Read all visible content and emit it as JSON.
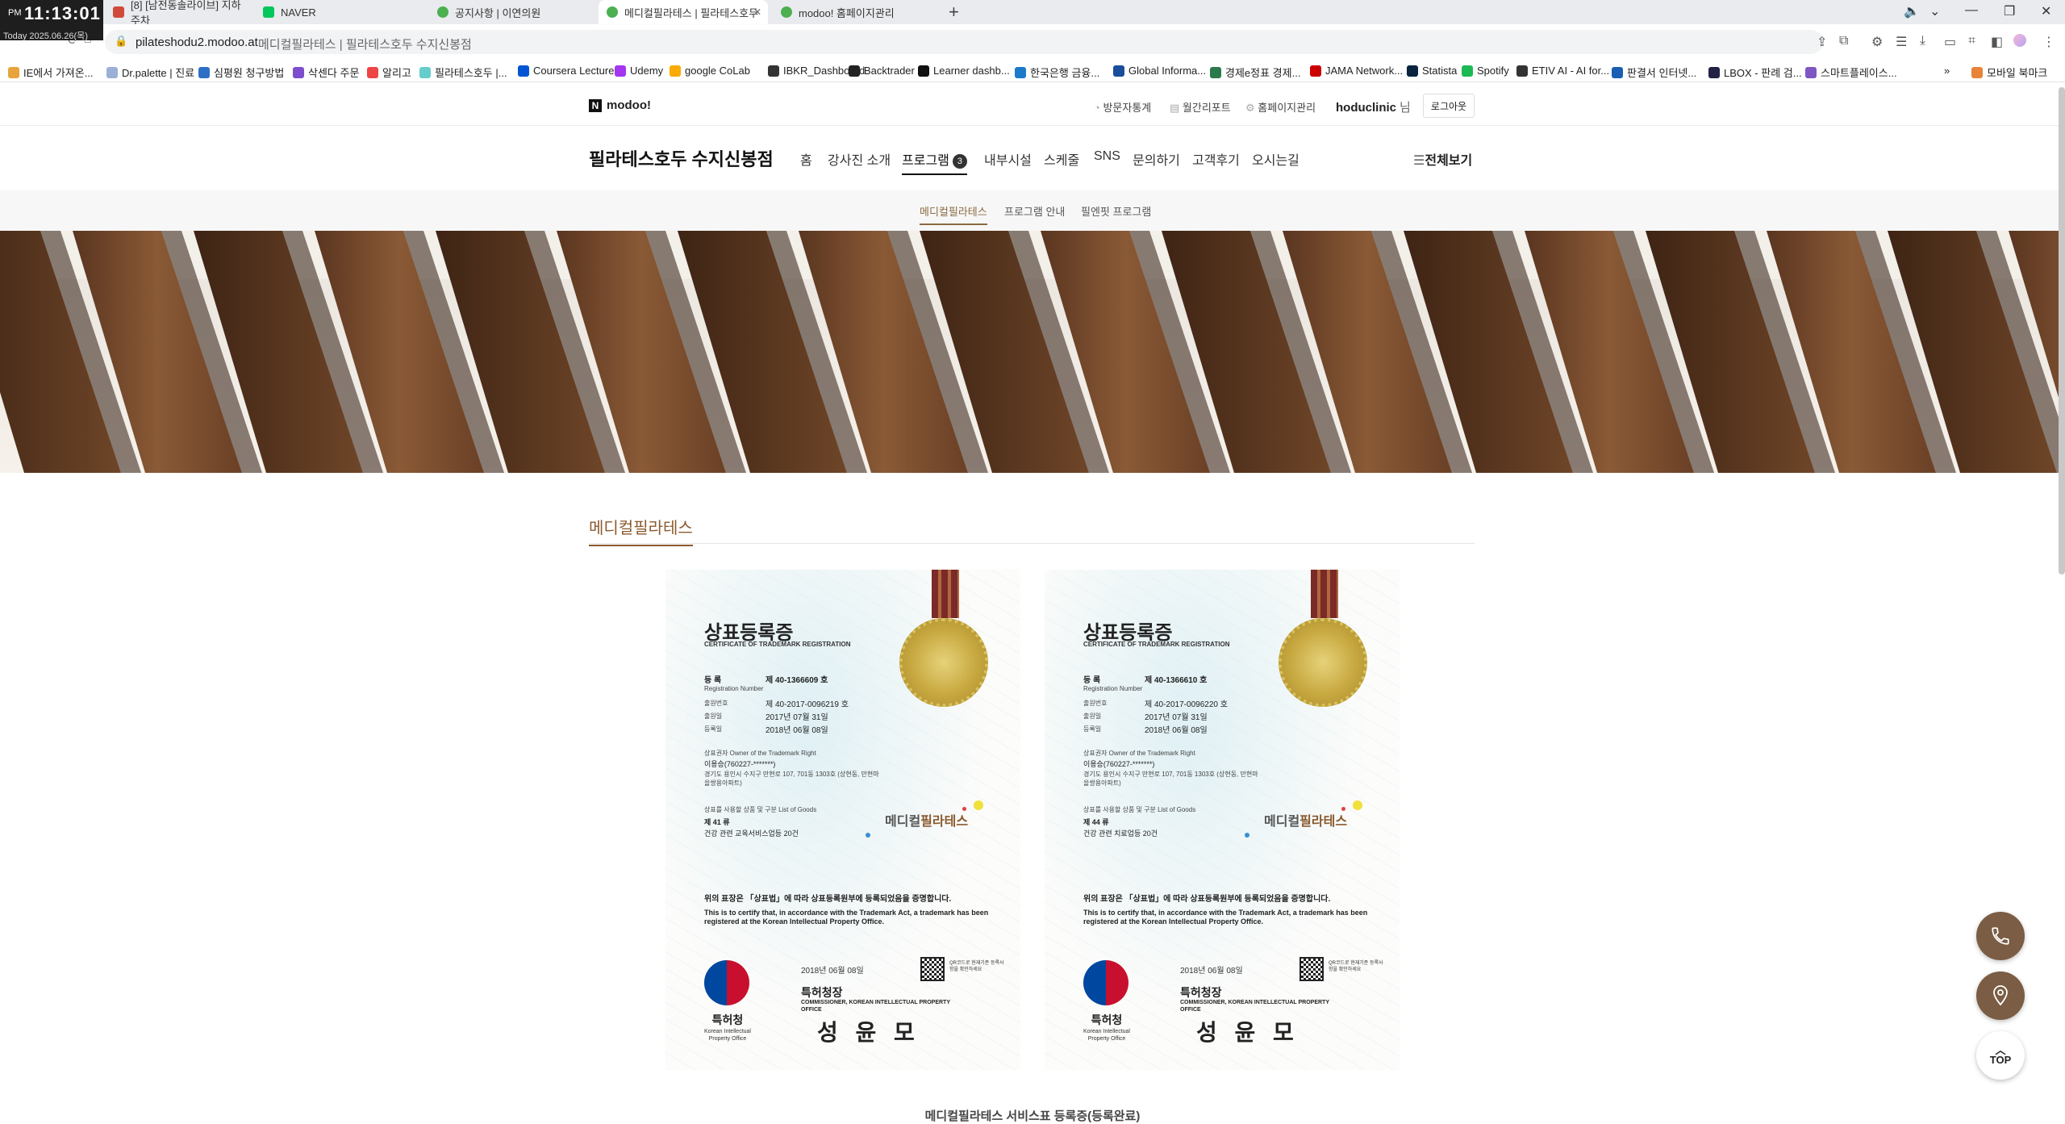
{
  "clock": {
    "ampm": "PM",
    "time": "11:13:01",
    "date": "Today 2025.06.26(목)"
  },
  "browser": {
    "tabs": [
      {
        "label": "[8] [남전동솔라이브] 지하 주차",
        "color": "#d04a3a"
      },
      {
        "label": "NAVER",
        "color": "#03c75a"
      },
      {
        "label": "공지사항 | 이연의원",
        "color": "#4caf50"
      },
      {
        "label": "메디컬필라테스 | 필라테스호두",
        "color": "#4caf50"
      },
      {
        "label": "modoo! 홈페이지관리",
        "color": "#4caf50"
      }
    ],
    "new_tab": "+",
    "url": "pilateshodu2.modoo.at",
    "page_title": "메디컬필라테스 | 필라테스호두 수지신봉점"
  },
  "bookmarks": [
    {
      "label": "IE에서 가져온...",
      "color": "#e8a33c"
    },
    {
      "label": "Dr.palette | 진료",
      "color": "#9bb0d6"
    },
    {
      "label": "심평원 청구방법",
      "color": "#2e6fc6"
    },
    {
      "label": "삭센다 주문",
      "color": "#7c4dcc"
    },
    {
      "label": "알리고",
      "color": "#e44"
    },
    {
      "label": "필라테스호두 |...",
      "color": "#6cc"
    },
    {
      "label": "Coursera Lecture",
      "color": "#0056d2"
    },
    {
      "label": "Udemy",
      "color": "#a435f0"
    },
    {
      "label": "google CoLab",
      "color": "#f9ab00"
    },
    {
      "label": "IBKR_Dashboard",
      "color": "#333"
    },
    {
      "label": "Backtrader",
      "color": "#222"
    },
    {
      "label": "Learner dashb...",
      "color": "#111"
    },
    {
      "label": "한국은행 금융...",
      "color": "#1d7ac9"
    },
    {
      "label": "Global Informa...",
      "color": "#1a4d9c"
    },
    {
      "label": "경제e정표 경제...",
      "color": "#2b7a4b"
    },
    {
      "label": "JAMA Network...",
      "color": "#c00"
    },
    {
      "label": "Statista",
      "color": "#0a2540"
    },
    {
      "label": "Spotify",
      "color": "#1db954"
    },
    {
      "label": "ETIV AI - AI for...",
      "color": "#333"
    },
    {
      "label": "판결서 인터넷...",
      "color": "#1a5fb4"
    },
    {
      "label": "LBOX - 판례 검...",
      "color": "#224"
    },
    {
      "label": "스마트플레이스...",
      "color": "#7e57c2"
    }
  ],
  "bookmarks_more": "»",
  "mobile_bookmarks": "모바일 북마크",
  "site": {
    "logo": "modoo!",
    "toplinks": [
      "방문자통계",
      "월간리포트",
      "홈페이지관리"
    ],
    "user": "hoduclinic",
    "user_suffix": "님",
    "logout": "로그아웃",
    "name": "필라테스호두 수지신봉점",
    "menu": [
      "홈",
      "강사진 소개",
      "프로그램",
      "내부시설",
      "스케줄",
      "SNS",
      "문의하기",
      "고객후기",
      "오시는길"
    ],
    "program_badge": "3",
    "all_view": "전체보기",
    "submenu": [
      "메디컬필라테스",
      "프로그램 안내",
      "필엔핏 프로그램"
    ],
    "section_title": "메디컬필라테스",
    "caption": "메디컬필라테스 서비스표 등록증(등록완료)"
  },
  "certs": [
    {
      "title": "상표등록증",
      "title_en": "CERTIFICATE OF TRADEMARK REGISTRATION",
      "reg_label": "등 록",
      "reg_label_en": "Registration Number",
      "reg_no": "제 40-1366609 호",
      "app_label": "출원번호",
      "app_no": "제 40-2017-0096219 호",
      "filing_label": "출원일",
      "filing_date": "2017년 07월 31일",
      "reg_date_label": "등록일",
      "reg_date": "2018년 06월 08일",
      "owner_label": "상표권자 Owner of the Trademark Right",
      "owner": "이용승(760227-*******)",
      "address": "경기도 용인시 수지구 만현로 107, 701동 1303호 (상현동, 만현마을쌍용아파트)",
      "goods_label": "상표를 사용할 상품 및 구분 List of Goods",
      "goods_class": "제 41 류",
      "goods": "건강 관련 교육서비스업등 20건",
      "brand_a": "메디컬",
      "brand_b": "필라테스",
      "decl_ko": "위의 표장은 「상표법」에 따라 상표등록원부에 등록되었음을 증명합니다.",
      "decl_en": "This is to certify that, in accordance with the Trademark Act, a trademark has been registered at the Korean Intellectual Property Office.",
      "issue_date": "2018년 06월 08일",
      "qr_text": "QR코드로 현재기준 등록사항을 확인하세요",
      "office": "특허청",
      "office_en": "Korean Intellectual Property Office",
      "commissioner": "특허청장",
      "commissioner_en": "COMMISSIONER, KOREAN INTELLECTUAL PROPERTY OFFICE",
      "signature": "성 윤 모"
    },
    {
      "title": "상표등록증",
      "title_en": "CERTIFICATE OF TRADEMARK REGISTRATION",
      "reg_label": "등 록",
      "reg_label_en": "Registration Number",
      "reg_no": "제 40-1366610 호",
      "app_label": "출원번호",
      "app_no": "제 40-2017-0096220 호",
      "filing_label": "출원일",
      "filing_date": "2017년 07월 31일",
      "reg_date_label": "등록일",
      "reg_date": "2018년 06월 08일",
      "owner_label": "상표권자 Owner of the Trademark Right",
      "owner": "이용승(760227-*******)",
      "address": "경기도 용인시 수지구 만현로 107, 701동 1303호 (상현동, 만현마을쌍용아파트)",
      "goods_label": "상표를 사용할 상품 및 구분 List of Goods",
      "goods_class": "제 44 류",
      "goods": "건강 관련 치료업등 20건",
      "brand_a": "메디컬",
      "brand_b": "필라테스",
      "decl_ko": "위의 표장은 「상표법」에 따라 상표등록원부에 등록되었음을 증명합니다.",
      "decl_en": "This is to certify that, in accordance with the Trademark Act, a trademark has been registered at the Korean Intellectual Property Office.",
      "issue_date": "2018년 06월 08일",
      "qr_text": "QR코드로 현재기준 등록사항을 확인하세요",
      "office": "특허청",
      "office_en": "Korean Intellectual Property Office",
      "commissioner": "특허청장",
      "commissioner_en": "COMMISSIONER, KOREAN INTELLECTUAL PROPERTY OFFICE",
      "signature": "성 윤 모"
    }
  ],
  "fab": {
    "top": "TOP",
    "top_arrow": "︿"
  },
  "colors": {
    "accent": "#8a5a2e",
    "fab": "#7a5d44"
  }
}
